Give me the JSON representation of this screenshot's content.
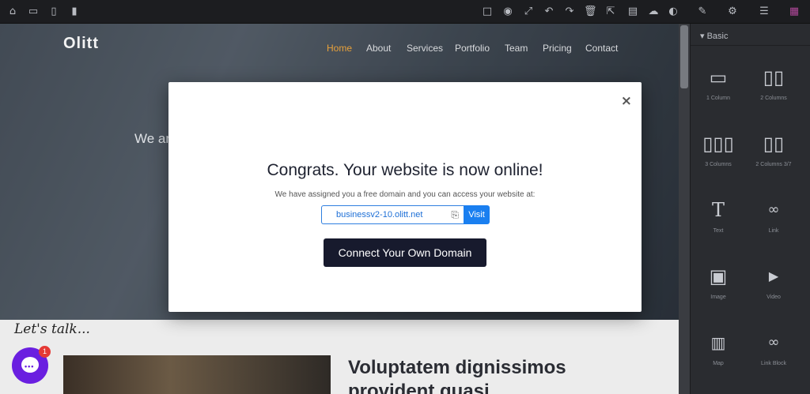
{
  "toolbar": {
    "left_icons": [
      "home-icon",
      "desktop-icon",
      "tablet-icon",
      "mobile-icon"
    ],
    "right_icons": [
      "square-icon",
      "eye-icon",
      "fullscreen-icon",
      "undo-icon",
      "redo-icon",
      "trash-icon",
      "external-link-icon",
      "code-icon",
      "cloud-upload-icon",
      "toggle-icon",
      "brush-icon",
      "gear-icon",
      "menu-icon",
      "grid-icon"
    ]
  },
  "site": {
    "logo": "Olitt",
    "nav": [
      "Home",
      "About",
      "Services",
      "Portfolio",
      "Team",
      "Pricing",
      "Contact"
    ],
    "hero_text": "We ar",
    "lets_talk": "Let's talk...",
    "headline_1": "Voluptatem dignissimos",
    "headline_2": "provident quasi"
  },
  "panel": {
    "section": "Basic",
    "blocks": [
      {
        "label": "1 Column",
        "icon": "single-column-icon"
      },
      {
        "label": "2 Columns",
        "icon": "two-columns-icon"
      },
      {
        "label": "3 Columns",
        "icon": "three-columns-icon"
      },
      {
        "label": "2 Columns 3/7",
        "icon": "two-columns-37-icon"
      },
      {
        "label": "Text",
        "icon": "text-icon"
      },
      {
        "label": "Link",
        "icon": "link-icon"
      },
      {
        "label": "Image",
        "icon": "image-icon"
      },
      {
        "label": "Video",
        "icon": "video-icon"
      },
      {
        "label": "Map",
        "icon": "map-icon"
      },
      {
        "label": "Link Block",
        "icon": "link-block-icon"
      }
    ]
  },
  "modal": {
    "title": "Congrats. Your website is now online!",
    "subtitle": "We have assigned you a free domain and you can access your website at:",
    "domain": "businessv2-10.olitt.net",
    "visit_label": "Visit",
    "connect_label": "Connect Your Own Domain",
    "close_glyph": "×"
  },
  "chat": {
    "badge_count": "1"
  },
  "colors": {
    "accent": "#1a7ff0",
    "connect_button": "#171a2d",
    "chat": "#6a1fe0",
    "nav_active": "#e8a13a"
  }
}
